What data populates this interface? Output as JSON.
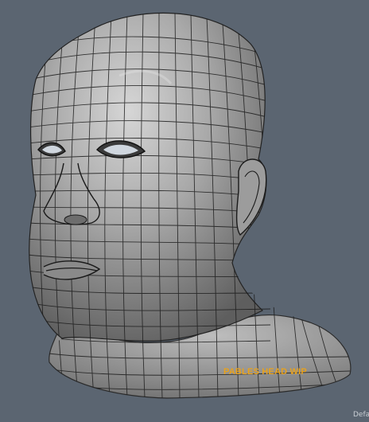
{
  "viewport": {
    "annotation_text": "PABLES HEAD WIP",
    "camera_label": "Default",
    "background_color": "#5b6571",
    "annotation_color": "#e9a21c",
    "model_description_icon": "head-mesh-icon"
  }
}
